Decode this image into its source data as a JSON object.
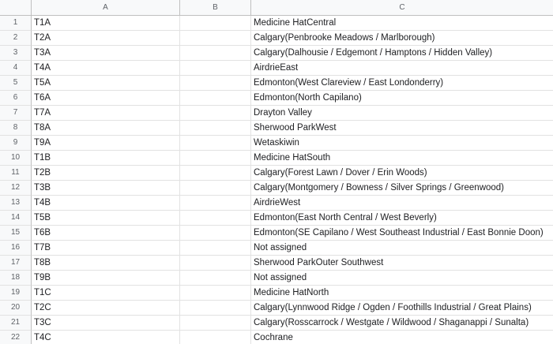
{
  "columns": {
    "a": "A",
    "b": "B",
    "c": "C"
  },
  "rows": [
    {
      "num": "1",
      "a": "T1A",
      "b": "",
      "c": "Medicine HatCentral"
    },
    {
      "num": "2",
      "a": "T2A",
      "b": "",
      "c": "Calgary(Penbrooke Meadows / Marlborough)"
    },
    {
      "num": "3",
      "a": "T3A",
      "b": "",
      "c": "Calgary(Dalhousie / Edgemont / Hamptons / Hidden Valley)"
    },
    {
      "num": "4",
      "a": "T4A",
      "b": "",
      "c": "AirdrieEast"
    },
    {
      "num": "5",
      "a": "T5A",
      "b": "",
      "c": "Edmonton(West Clareview / East Londonderry)"
    },
    {
      "num": "6",
      "a": "T6A",
      "b": "",
      "c": "Edmonton(North Capilano)"
    },
    {
      "num": "7",
      "a": "T7A",
      "b": "",
      "c": "Drayton Valley"
    },
    {
      "num": "8",
      "a": "T8A",
      "b": "",
      "c": "Sherwood ParkWest"
    },
    {
      "num": "9",
      "a": "T9A",
      "b": "",
      "c": "Wetaskiwin"
    },
    {
      "num": "10",
      "a": "T1B",
      "b": "",
      "c": "Medicine HatSouth"
    },
    {
      "num": "11",
      "a": "T2B",
      "b": "",
      "c": "Calgary(Forest Lawn / Dover / Erin Woods)"
    },
    {
      "num": "12",
      "a": "T3B",
      "b": "",
      "c": "Calgary(Montgomery / Bowness / Silver Springs / Greenwood)"
    },
    {
      "num": "13",
      "a": "T4B",
      "b": "",
      "c": "AirdrieWest"
    },
    {
      "num": "14",
      "a": "T5B",
      "b": "",
      "c": "Edmonton(East North Central / West Beverly)"
    },
    {
      "num": "15",
      "a": "T6B",
      "b": "",
      "c": "Edmonton(SE Capilano / West Southeast Industrial / East Bonnie Doon)"
    },
    {
      "num": "16",
      "a": "T7B",
      "b": "",
      "c": "Not assigned"
    },
    {
      "num": "17",
      "a": "T8B",
      "b": "",
      "c": "Sherwood ParkOuter Southwest"
    },
    {
      "num": "18",
      "a": "T9B",
      "b": "",
      "c": "Not assigned"
    },
    {
      "num": "19",
      "a": "T1C",
      "b": "",
      "c": "Medicine HatNorth"
    },
    {
      "num": "20",
      "a": "T2C",
      "b": "",
      "c": "Calgary(Lynnwood Ridge / Ogden / Foothills Industrial / Great Plains)"
    },
    {
      "num": "21",
      "a": "T3C",
      "b": "",
      "c": "Calgary(Rosscarrock / Westgate / Wildwood / Shaganappi / Sunalta)"
    },
    {
      "num": "22",
      "a": "T4C",
      "b": "",
      "c": "Cochrane"
    }
  ]
}
